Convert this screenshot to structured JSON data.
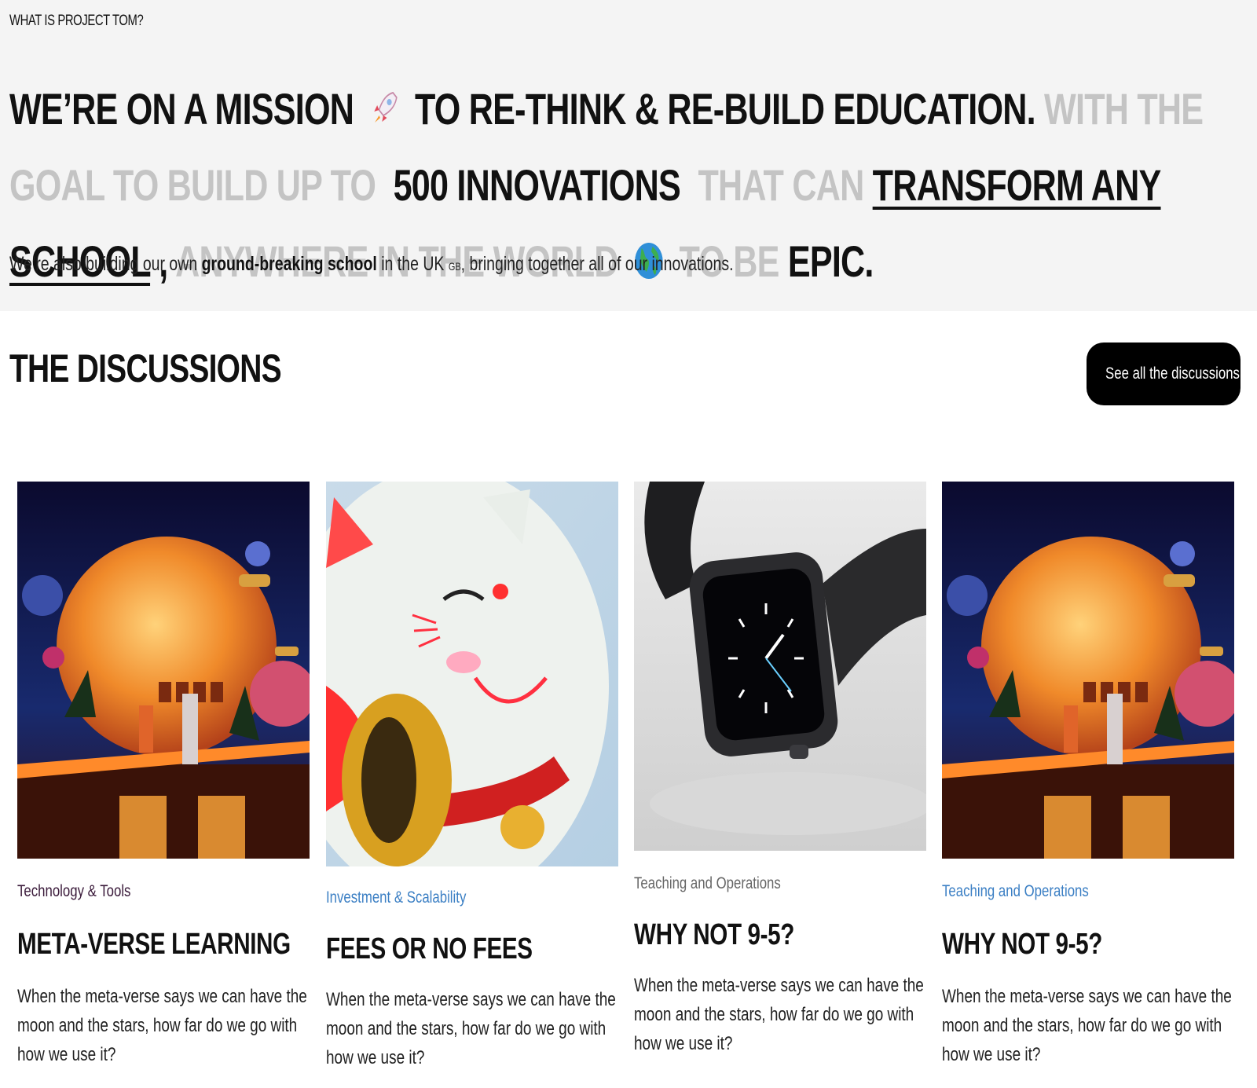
{
  "hero": {
    "eyebrow": "WHAT IS PROJECT TOM?",
    "mission": {
      "part1": "WE’RE ON A MISSION",
      "part2": "TO RE-THINK & RE-BUILD EDUCATION.",
      "part3": "WITH THE GOAL TO BUILD UP TO",
      "number": "500",
      "part4": "INNOVATIONS",
      "part5": "THAT CAN",
      "link": "TRANSFORM ANY SCHOOL",
      "comma": ",",
      "part6": "ANYWHERE IN THE WORLD",
      "part7": "TO BE",
      "part8": "EPIC."
    },
    "sub": {
      "a": "We’re also building our own",
      "bold": "ground-breaking school",
      "b": "in the UK",
      "flag": "GB",
      "c": ", bringing together all of our innovations."
    }
  },
  "discussions": {
    "title": "THE DISCUSSIONS",
    "see_all": "See all the discussions →",
    "cards": [
      {
        "category": "Technology & Tools",
        "category_color": "#3a1a3a",
        "title": "META-VERSE LEARNING",
        "desc": "When the meta-verse says we can have the moon and the stars, how far do we go with how we use it?",
        "image": "metaverse-scene"
      },
      {
        "category": "Investment & Scalability",
        "category_color": "#3b7fc4",
        "title": "FEES OR NO FEES",
        "desc": "When the meta-verse says we can have the moon and the stars, how far do we go with how we use it?",
        "image": "lucky-cat"
      },
      {
        "category": "Teaching and Operations",
        "category_color": "#666666",
        "title": "WHY NOT 9-5?",
        "desc": "When the meta-verse says we can have the moon and the stars, how far do we go with how we use it?",
        "image": "smartwatch"
      },
      {
        "category": "Teaching and Operations",
        "category_color": "#3b7fc4",
        "title": "WHY NOT 9-5?",
        "desc": "When the meta-verse says we can have the moon and the stars, how far do we go with how we use it?",
        "image": "metaverse-scene"
      }
    ]
  },
  "colors": {
    "dark": "#111111",
    "light_text": "#c4c4c4",
    "hero_bg": "#f4f4f4",
    "button_bg": "#000000"
  }
}
